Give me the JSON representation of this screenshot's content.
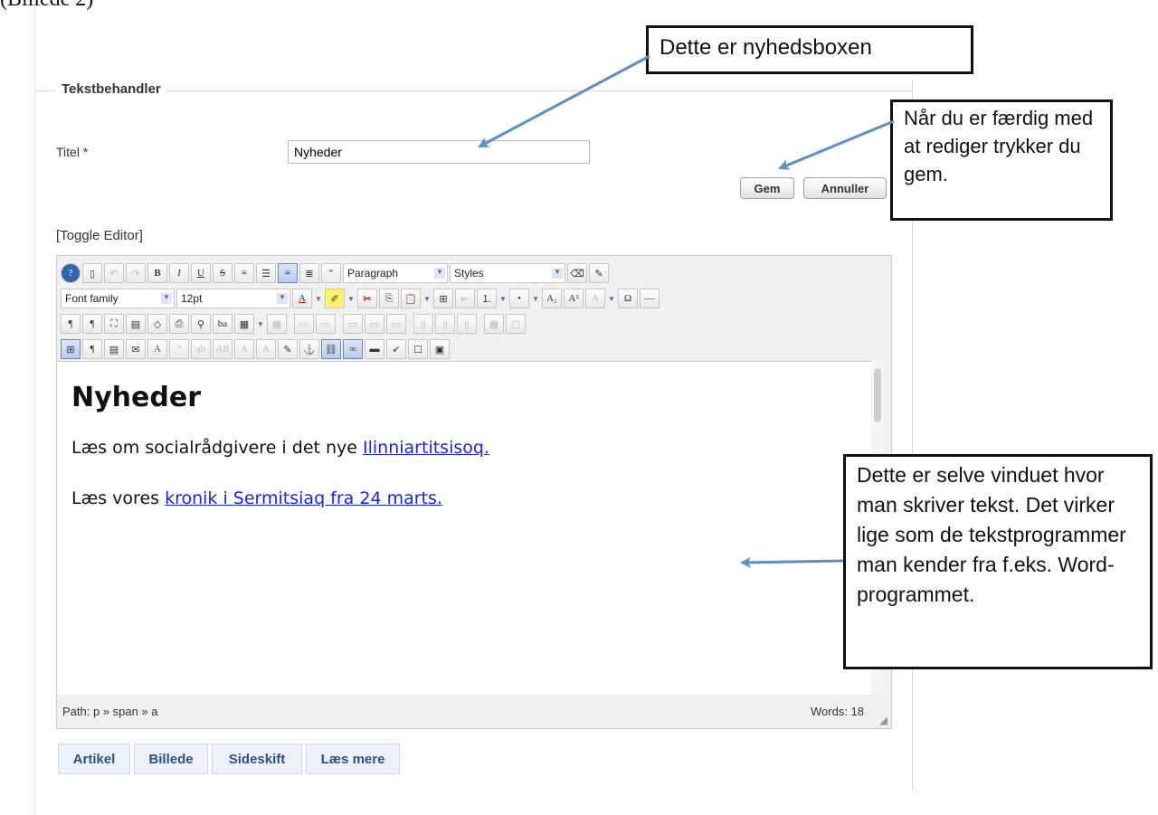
{
  "caption": "(Billede 2)",
  "form": {
    "legend": "Tekstbehandler",
    "title_label": "Titel",
    "required_mark": "*",
    "title_value": "Nyheder",
    "save_label": "Gem",
    "cancel_label": "Annuller",
    "toggle_editor": "[Toggle Editor]"
  },
  "toolbar": {
    "format_select": "Paragraph",
    "styles_select": "Styles",
    "font_family_select": "Font family",
    "font_size_select": "12pt"
  },
  "content": {
    "heading": "Nyheder",
    "p1_text": "Læs om socialrådgivere i det nye ",
    "p1_link": "Ilinniartitsisoq.",
    "p2_text": "Læs vores ",
    "p2_link": "kronik i Sermitsiaq fra 24 marts."
  },
  "status": {
    "path": "Path:  p » span » a",
    "words": "Words: 18"
  },
  "bottom_buttons": [
    "Artikel",
    "Billede",
    "Sideskift",
    "Læs mere"
  ],
  "callouts": {
    "news_box": "Dette er nyhedsboxen",
    "save_hint": "Når du er færdig med at rediger trykker du gem.",
    "editor_hint": "Dette er selve vinduet hvor man skriver tekst. Det virker lige som de tekstprogrammer man kender fra f.eks. Word-programmet."
  },
  "colors": {
    "link": "#1a25d6",
    "callout_border": "#111111",
    "arrow": "#5b8fc7"
  }
}
